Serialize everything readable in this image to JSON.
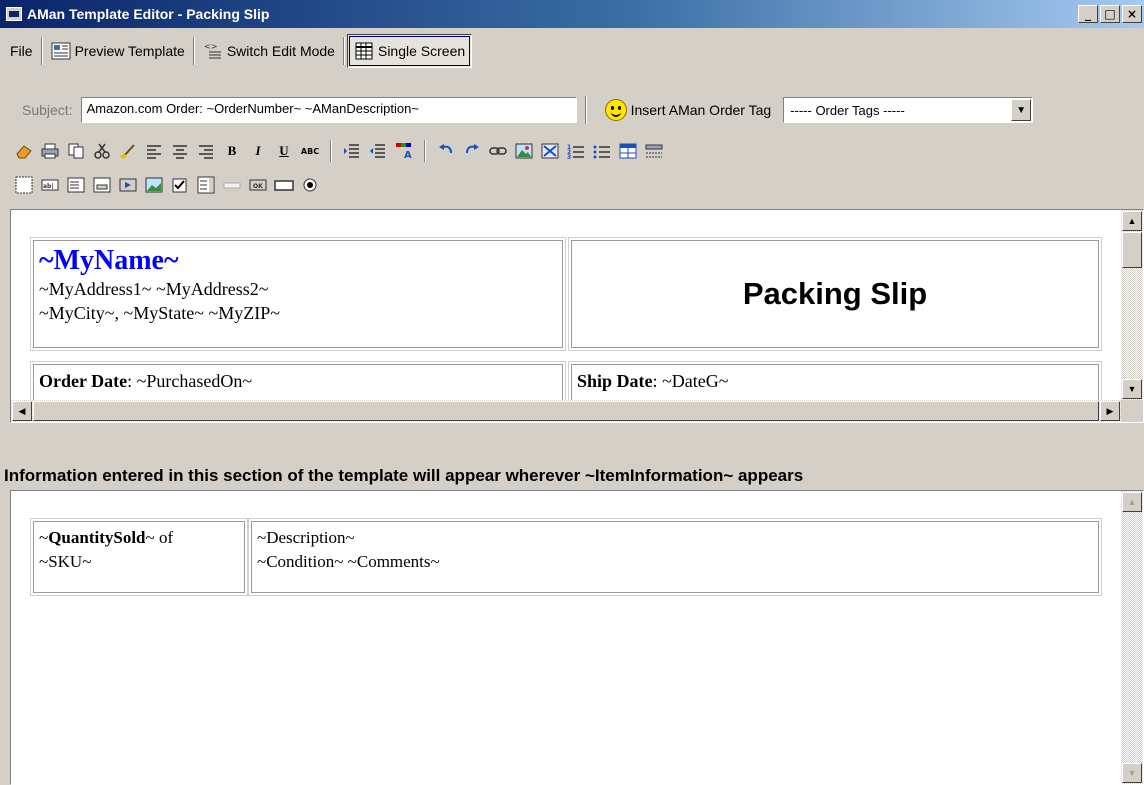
{
  "window": {
    "title": "AMan Template Editor - Packing Slip",
    "minimize": "_",
    "maximize": "□",
    "close": "×"
  },
  "toolbar": {
    "file": "File",
    "preview_template": "Preview Template",
    "switch_edit_mode": "Switch Edit Mode",
    "single_screen": "Single Screen"
  },
  "subject": {
    "label": "Subject:",
    "value": "Amazon.com Order: ~OrderNumber~  ~AManDescription~",
    "insert_tag_label": "Insert AMan Order Tag",
    "order_tags_selected": "-----  Order Tags  -----"
  },
  "format_toolbar": {
    "bold": "B",
    "italic": "I",
    "underline": "U",
    "spell": "ABC"
  },
  "header_template": {
    "my_name": "~MyName~",
    "address_line1": "~MyAddress1~ ~MyAddress2~",
    "address_line2": "~MyCity~, ~MyState~ ~MyZIP~",
    "title": "Packing Slip",
    "order_date_label": "Order Date",
    "order_date_value": ": ~PurchasedOn~",
    "ship_date_label": "Ship Date",
    "ship_date_value": ": ~DateG~"
  },
  "item_section": {
    "notice": "Information entered in this section of the template will appear wherever ~ItemInformation~ appears",
    "qty_prefix": "~",
    "qty_tag": "QuantitySold",
    "qty_suffix": "~ of",
    "sku": "~SKU~",
    "description": "~Description~",
    "condition_comments": "~Condition~   ~Comments~"
  }
}
